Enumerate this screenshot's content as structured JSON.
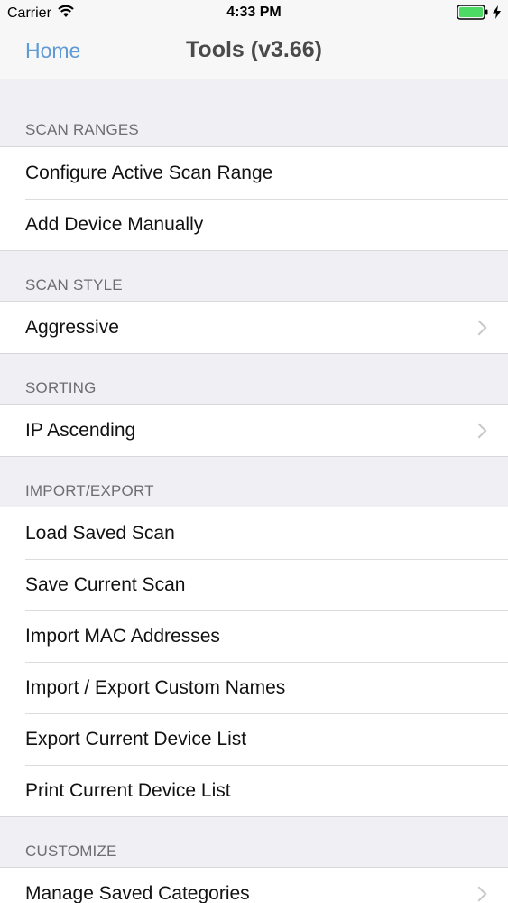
{
  "status_bar": {
    "carrier": "Carrier",
    "time": "4:33 PM"
  },
  "nav": {
    "back_label": "Home",
    "title": "Tools (v3.66)",
    "back_color": "#5e9ad3"
  },
  "sections": {
    "scan_ranges": {
      "header": "SCAN RANGES",
      "items": [
        "Configure Active Scan Range",
        "Add Device Manually"
      ]
    },
    "scan_style": {
      "header": "SCAN STYLE",
      "items": [
        "Aggressive"
      ]
    },
    "sorting": {
      "header": "SORTING",
      "items": [
        "IP Ascending"
      ]
    },
    "import_export": {
      "header": "IMPORT/EXPORT",
      "items": [
        "Load Saved Scan",
        "Save Current Scan",
        "Import MAC Addresses",
        "Import / Export Custom Names",
        "Export Current Device List",
        "Print Current Device List"
      ]
    },
    "customize": {
      "header": "CUSTOMIZE",
      "items": [
        "Manage Saved Categories"
      ]
    }
  },
  "icons": {
    "wifi": "wifi-icon",
    "battery": "battery-icon",
    "charging": "charging-bolt-icon",
    "chevron": "chevron-right-icon"
  },
  "colors": {
    "battery_fill": "#4cd964",
    "background": "#efeff4"
  }
}
